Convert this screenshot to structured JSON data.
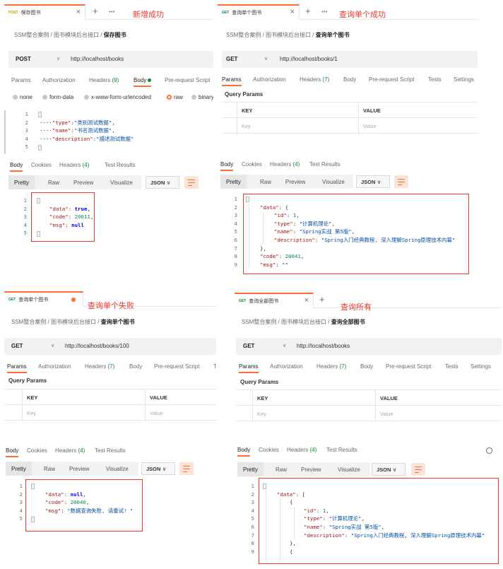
{
  "annotations": {
    "save_success": "新增成功",
    "query_single_success": "查询单个成功",
    "query_single_fail": "查询单个失败",
    "query_all": "查询所有"
  },
  "panels": {
    "save": {
      "tab_method": "POST",
      "tab_name": "保存图书",
      "breadcrumb_parent": "SSM整合案例 / 图书模块后台接口 /",
      "breadcrumb_current": "保存图书",
      "method": "POST",
      "url": "http://localhost/books",
      "req_tabs": [
        "Params",
        "Authorization",
        "Headers",
        "(9)",
        "Body",
        "Pre-request Script"
      ],
      "body_modes": [
        "none",
        "form-data",
        "x-www-form-urlencoded",
        "raw",
        "binary"
      ],
      "request_body": {
        "line_numbers": [
          "1",
          "2",
          "3",
          "4",
          "5"
        ],
        "type_key": "\"type\"",
        "type_val": "\"类别测试数据\"",
        "name_key": "\"name\"",
        "name_val": "\"书名测试数据\"",
        "desc_key": "\"description\"",
        "desc_val": "\"描述测试数据\""
      },
      "resp_tabs": [
        "Body",
        "Cookies",
        "Headers",
        "(4)",
        "Test Results"
      ],
      "formats": [
        "Pretty",
        "Raw",
        "Preview",
        "Visualize"
      ],
      "format_select": "JSON",
      "response": {
        "line_numbers": [
          "1",
          "2",
          "3",
          "4",
          "5"
        ],
        "data_key": "\"data\"",
        "data_val": "true",
        "code_key": "\"code\"",
        "code_val": "20011",
        "msg_key": "\"msg\"",
        "msg_val": "null"
      }
    },
    "get_one": {
      "tab_method": "GET",
      "tab_name": "查询单个图书",
      "breadcrumb_parent": "SSM整合案例 / 图书模块后台接口 /",
      "breadcrumb_current": "查询单个图书",
      "method": "GET",
      "url": "http://localhost/books/1",
      "req_tabs": [
        "Params",
        "Authorization",
        "Headers",
        "(7)",
        "Body",
        "Pre-request Script",
        "Tests",
        "Settings"
      ],
      "query_params_title": "Query Params",
      "kv_headers": [
        "KEY",
        "VALUE"
      ],
      "kv_placeholders": [
        "Key",
        "Value"
      ],
      "resp_tabs": [
        "Body",
        "Cookies",
        "Headers",
        "(4)",
        "Test Results"
      ],
      "formats": [
        "Pretty",
        "Raw",
        "Preview",
        "Visualize"
      ],
      "format_select": "JSON",
      "response": {
        "line_numbers": [
          "1",
          "2",
          "3",
          "4",
          "5",
          "6",
          "7",
          "8",
          "9"
        ],
        "data_key": "\"data\"",
        "id_key": "\"id\"",
        "id_val": "1",
        "type_key": "\"type\"",
        "type_val": "\"计算机理论\"",
        "name_key": "\"name\"",
        "name_val": "\"Spring实战 第5版\"",
        "desc_key": "\"description\"",
        "desc_val": "\"Spring入门经典教程, 深入理解Spring原理技术内幕\"",
        "code_key": "\"code\"",
        "code_val": "20041",
        "msg_key": "\"msg\"",
        "msg_val": "\"\""
      }
    },
    "get_fail": {
      "tab_method": "GET",
      "tab_name": "查询单个图书",
      "breadcrumb_parent": "SSM整合案例 / 图书模块后台接口 /",
      "breadcrumb_current": "查询单个图书",
      "method": "GET",
      "url": "http://localhost/books/100",
      "req_tabs": [
        "Params",
        "Authorization",
        "Headers",
        "(7)",
        "Body",
        "Pre-request Script",
        "T"
      ],
      "query_params_title": "Query Params",
      "kv_headers": [
        "KEY",
        "VALUE"
      ],
      "kv_placeholders": [
        "Key",
        "Value"
      ],
      "resp_tabs": [
        "Body",
        "Cookies",
        "Headers",
        "(4)",
        "Test Results"
      ],
      "formats": [
        "Pretty",
        "Raw",
        "Preview",
        "Visualize"
      ],
      "format_select": "JSON",
      "response": {
        "line_numbers": [
          "1",
          "2",
          "3",
          "4",
          "5"
        ],
        "data_key": "\"data\"",
        "data_val": "null",
        "code_key": "\"code\"",
        "code_val": "20040",
        "msg_key": "\"msg\"",
        "msg_val": "\"数据查询失败, 请重试! \""
      }
    },
    "get_all": {
      "tab_method": "GET",
      "tab_name": "查询全部图书",
      "breadcrumb_parent": "SSM整合案例 / 图书模块后台接口 /",
      "breadcrumb_current": "查询全部图书",
      "method": "GET",
      "url": "http://localhost/books",
      "req_tabs": [
        "Params",
        "Authorization",
        "Headers",
        "(7)",
        "Body",
        "Pre-request Script",
        "Tests",
        "Settings"
      ],
      "query_params_title": "Query Params",
      "kv_headers": [
        "KEY",
        "VALUE"
      ],
      "kv_placeholders": [
        "Key",
        "Value"
      ],
      "resp_tabs": [
        "Body",
        "Cookies",
        "Headers",
        "(4)",
        "Test Results"
      ],
      "formats": [
        "Pretty",
        "Raw",
        "Preview",
        "Visualize"
      ],
      "format_select": "JSON",
      "response": {
        "line_numbers": [
          "1",
          "2",
          "3",
          "4",
          "5",
          "6",
          "7",
          "8",
          "9"
        ],
        "data_key": "\"data\"",
        "id_key": "\"id\"",
        "id_val": "1",
        "type_key": "\"type\"",
        "type_val": "\"计算机理论\"",
        "name_key": "\"name\"",
        "name_val": "\"Spring实战 第5版\"",
        "desc_key": "\"description\"",
        "desc_val": "\"Spring入门经典教程, 深入理解Spring原理技术内幕\""
      }
    }
  },
  "colors": {
    "accent": "#ff6c37",
    "annotation": "#e8362d",
    "count_green": "#0a8a2e",
    "post_method": "#c8a100",
    "get_method": "#0a8a2e"
  },
  "icons": [
    "close-icon",
    "plus-icon",
    "more-icon",
    "chevron-down-icon",
    "wrap-lines-icon",
    "globe-icon",
    "fold-icon"
  ]
}
